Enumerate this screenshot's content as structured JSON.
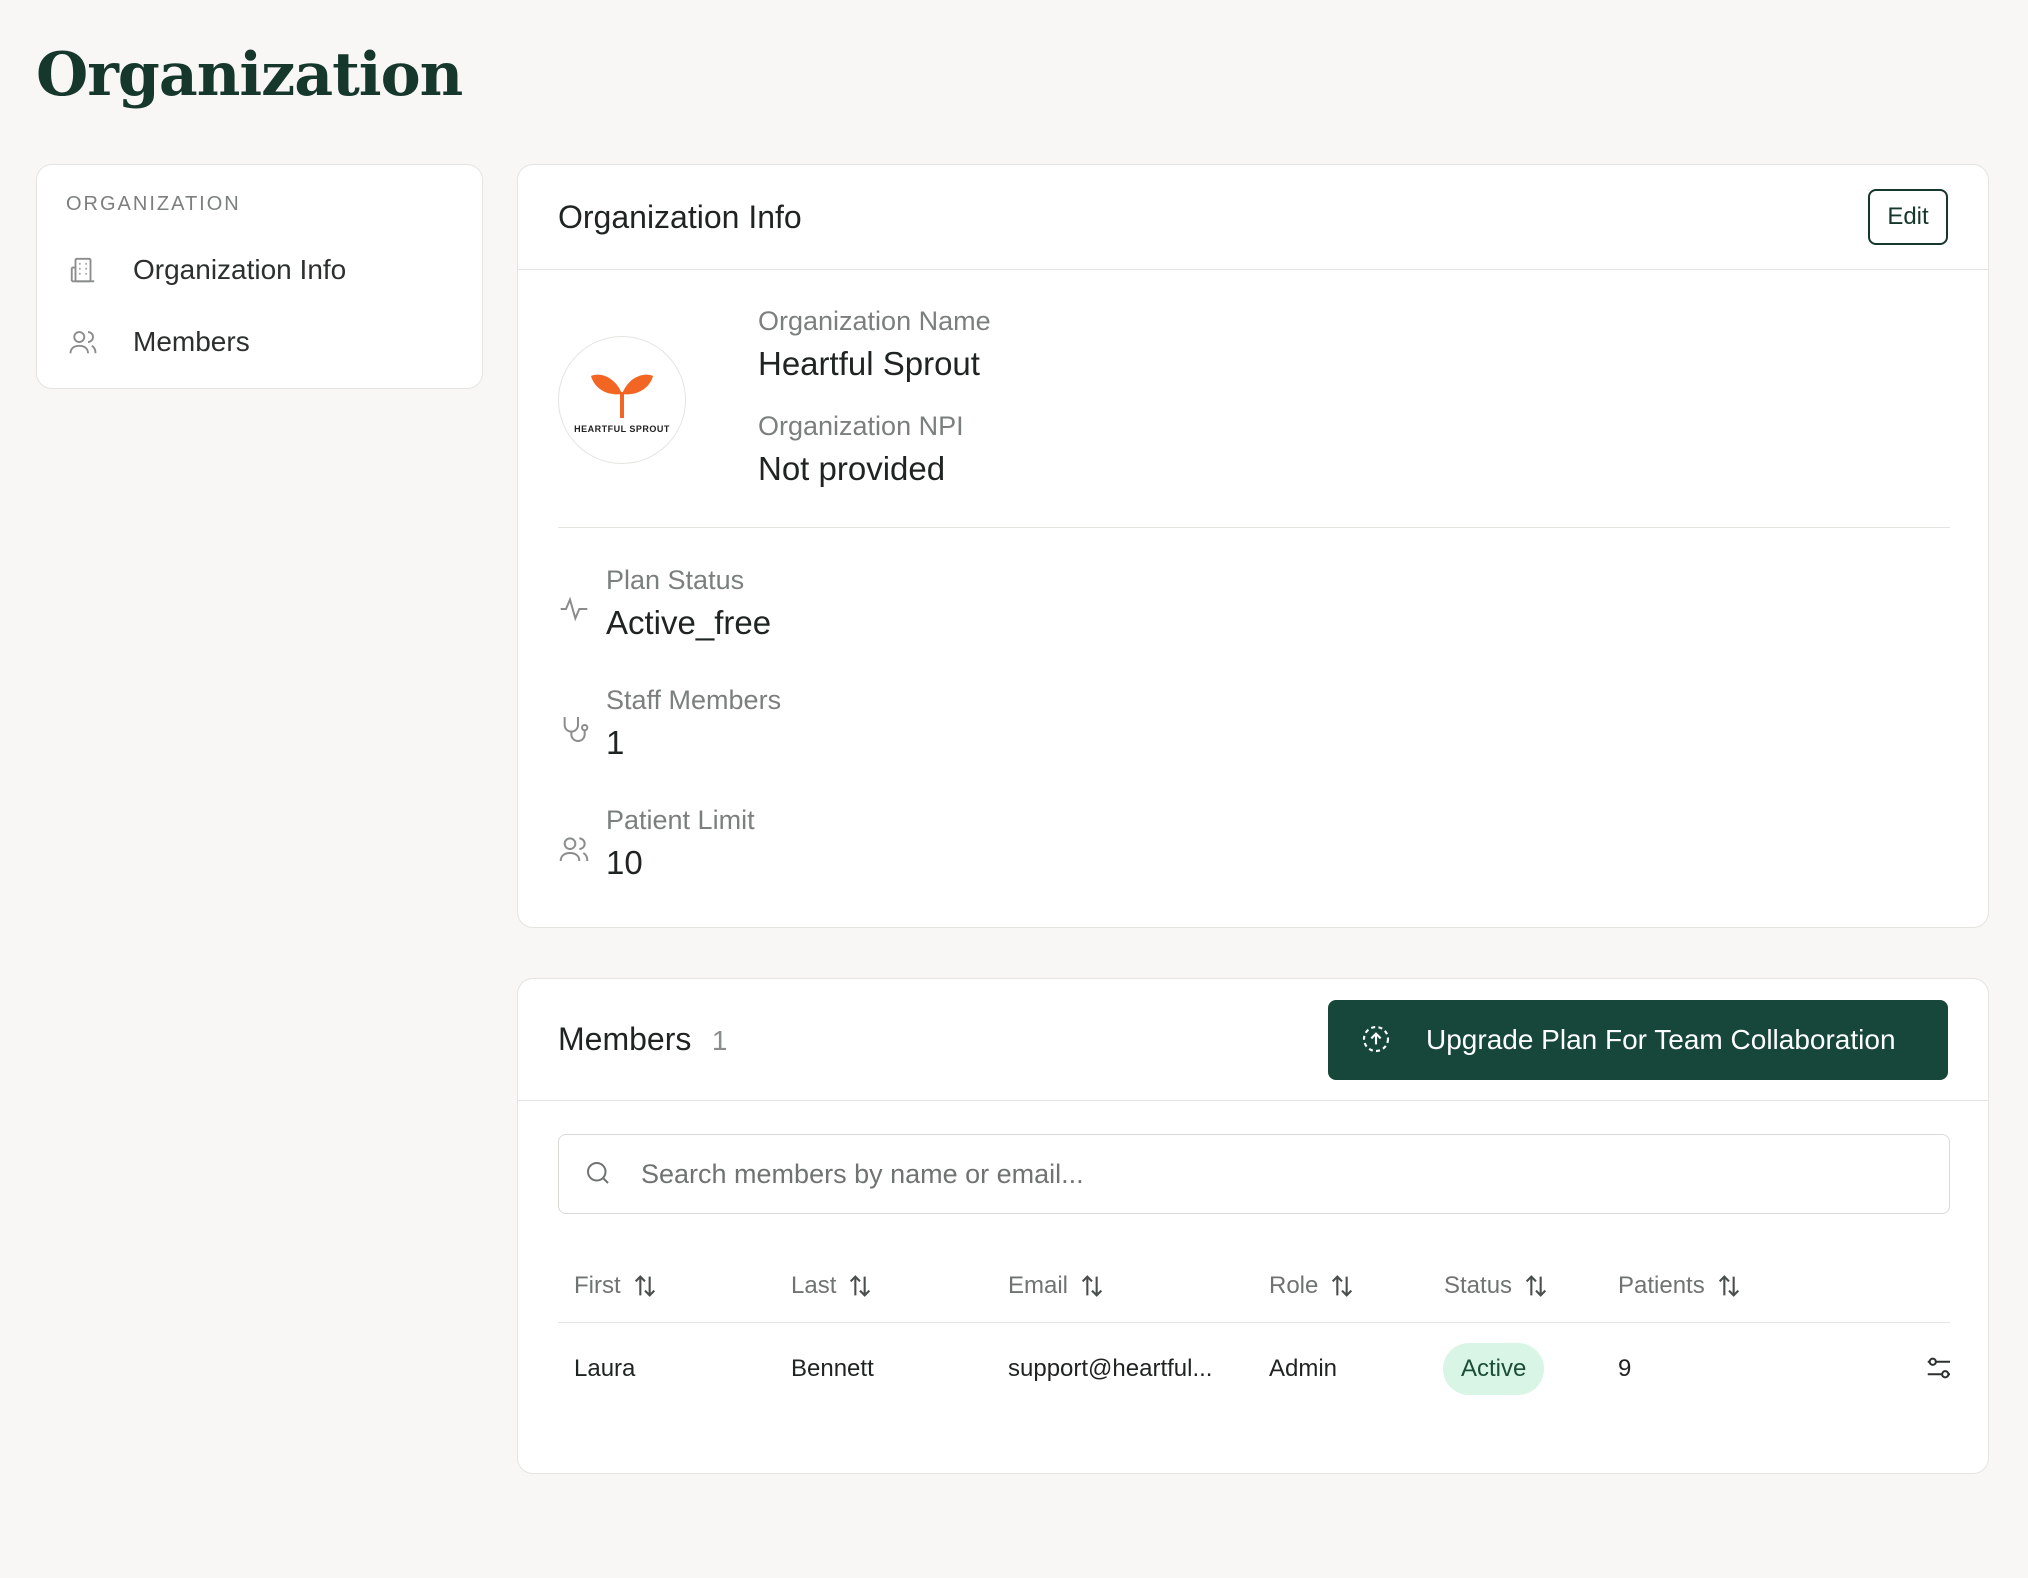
{
  "page": {
    "title": "Organization"
  },
  "sidebar": {
    "heading": "ORGANIZATION",
    "items": [
      {
        "label": "Organization Info",
        "icon": "building-icon"
      },
      {
        "label": "Members",
        "icon": "users-icon"
      }
    ]
  },
  "info": {
    "title": "Organization Info",
    "edit_label": "Edit",
    "logo_text": "HEARTFUL SPROUT",
    "name_label": "Organization Name",
    "name_value": "Heartful Sprout",
    "npi_label": "Organization NPI",
    "npi_value": "Not provided",
    "stats": [
      {
        "label": "Plan Status",
        "value": "Active_free",
        "icon": "activity-icon"
      },
      {
        "label": "Staff Members",
        "value": "1",
        "icon": "stethoscope-icon"
      },
      {
        "label": "Patient Limit",
        "value": "10",
        "icon": "users-icon"
      }
    ]
  },
  "members": {
    "title": "Members",
    "count": "1",
    "upgrade_label": "Upgrade Plan For Team Collaboration",
    "search_placeholder": "Search members by name or email...",
    "columns": [
      "First",
      "Last",
      "Email",
      "Role",
      "Status",
      "Patients"
    ],
    "rows": [
      {
        "first": "Laura",
        "last": "Bennett",
        "email": "support@heartful...",
        "role": "Admin",
        "status": "Active",
        "patients": "9"
      }
    ]
  },
  "colors": {
    "brand": "#16473a",
    "title": "#16372c",
    "badge_bg": "#d9f5e6",
    "logo_orange": "#f26522"
  }
}
